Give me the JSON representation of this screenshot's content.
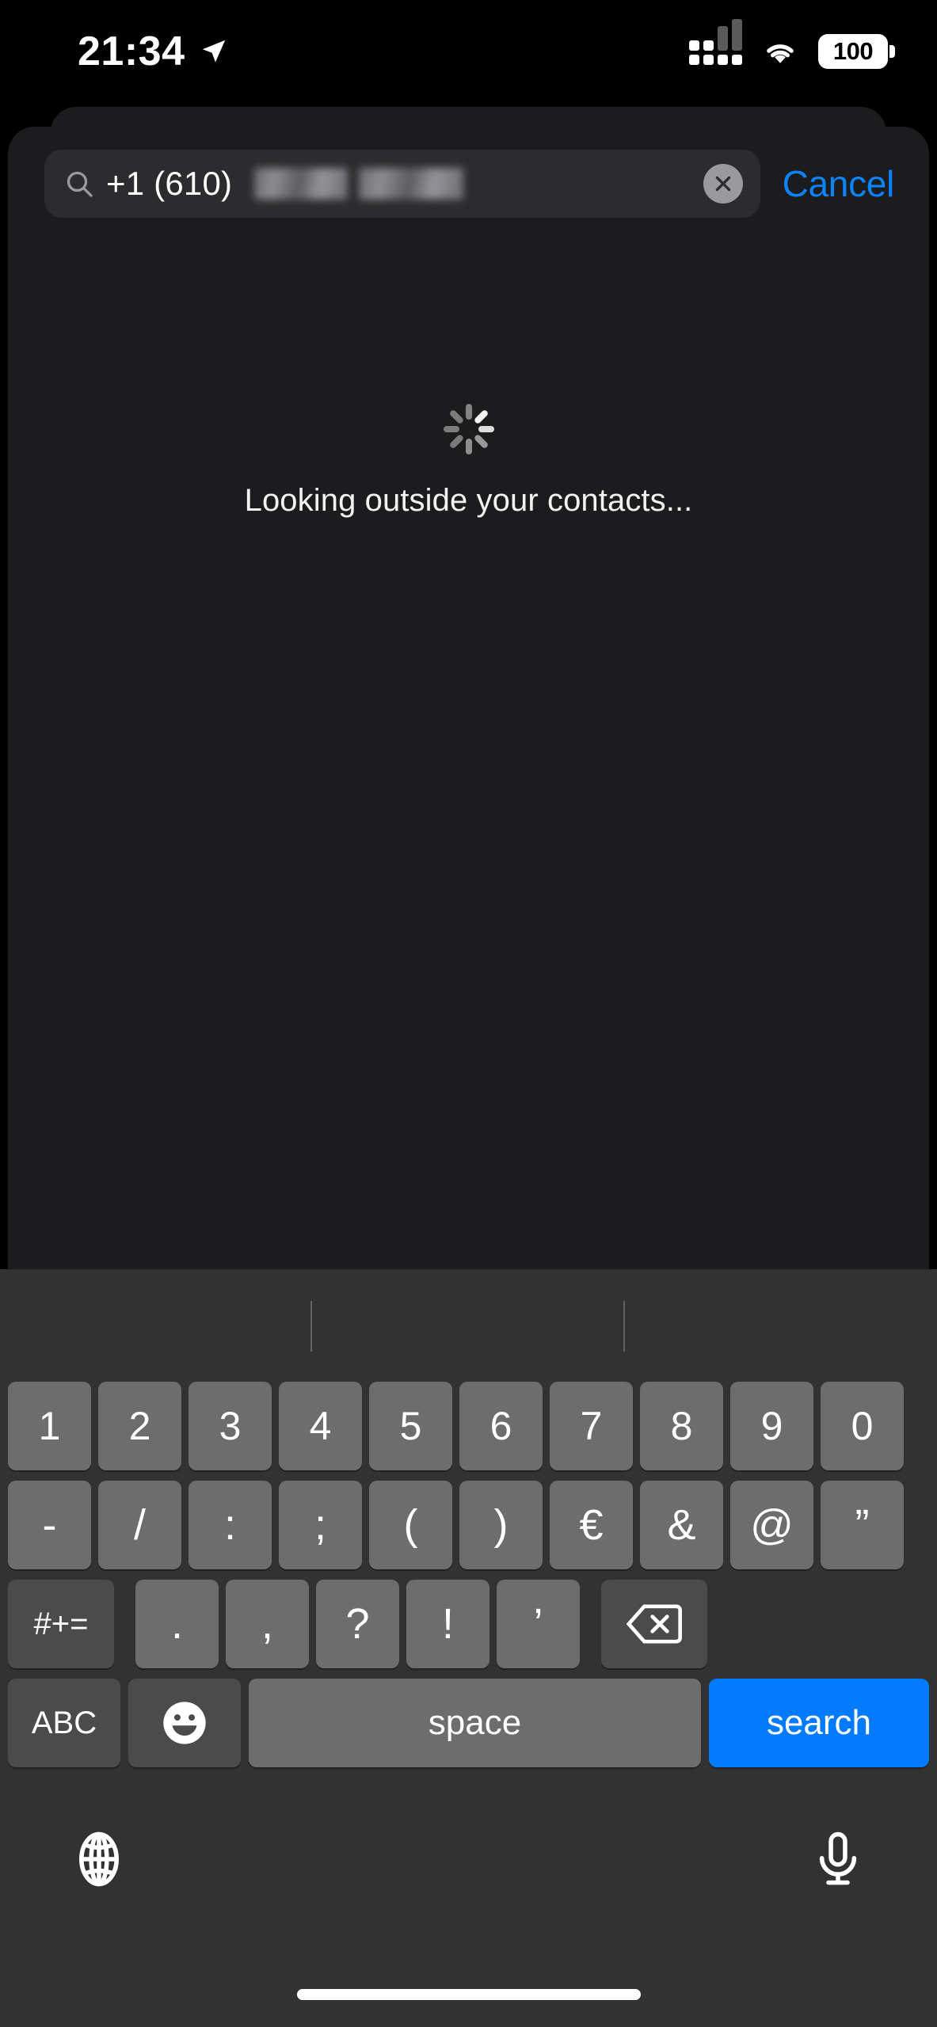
{
  "status_bar": {
    "time": "21:34",
    "location_icon": "location-arrow-icon",
    "signal_icon": "cellular-signal-icon",
    "wifi_icon": "wifi-icon",
    "battery_level": "100",
    "battery_icon": "battery-full-icon"
  },
  "search": {
    "magnifier_icon": "search-icon",
    "value": "+1 (610)",
    "value_redacted_suffix": "[redacted]",
    "clear_icon": "clear-circle-icon",
    "cancel_label": "Cancel"
  },
  "content": {
    "spinner_icon": "loading-spinner-icon",
    "status_text": "Looking outside your contacts..."
  },
  "keyboard": {
    "predictive_bar": {
      "suggestions": [
        "",
        "",
        ""
      ]
    },
    "rows": {
      "numbers": [
        "1",
        "2",
        "3",
        "4",
        "5",
        "6",
        "7",
        "8",
        "9",
        "0"
      ],
      "symbols": [
        "-",
        "/",
        ":",
        ";",
        "(",
        ")",
        "€",
        "&",
        "@",
        "”"
      ],
      "punctuation": [
        ".",
        ",",
        "?",
        "!",
        "’"
      ]
    },
    "shift_label": "#+=",
    "delete_icon": "backspace-icon",
    "abc_label": "ABC",
    "emoji_icon": "emoji-smiley-icon",
    "space_label": "space",
    "return_label": "search",
    "globe_icon": "globe-icon",
    "dictation_icon": "microphone-icon"
  },
  "colors": {
    "accent_blue": "#007aff",
    "cancel_blue": "#0a84ff",
    "sheet_bg": "#1c1c1e",
    "field_bg": "#2c2c2e",
    "keyboard_bg": "#323232",
    "key_bg": "#6d6d6d",
    "key_dark_bg": "#4b4b4b"
  }
}
